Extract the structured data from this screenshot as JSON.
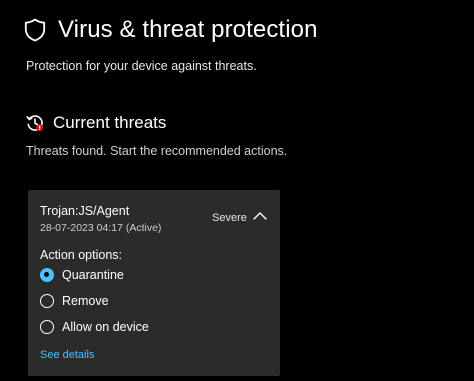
{
  "header": {
    "title": "Virus & threat protection",
    "subtitle": "Protection for your device against threats.",
    "icon": "shield-icon"
  },
  "current_threats": {
    "title": "Current threats",
    "description": "Threats found. Start the recommended actions.",
    "icon": "threat-history-icon"
  },
  "threat": {
    "name": "Trojan:JS/Agent",
    "date": "28-07-2023 04:17 (Active)",
    "severity": "Severe",
    "action_options_label": "Action options:",
    "options": [
      {
        "label": "Quarantine",
        "selected": true
      },
      {
        "label": "Remove",
        "selected": false
      },
      {
        "label": "Allow on device",
        "selected": false
      }
    ],
    "see_details": "See details"
  },
  "colors": {
    "background": "#000000",
    "card": "#2b2b2b",
    "accent": "#4cc2ff",
    "text": "#ffffff"
  }
}
